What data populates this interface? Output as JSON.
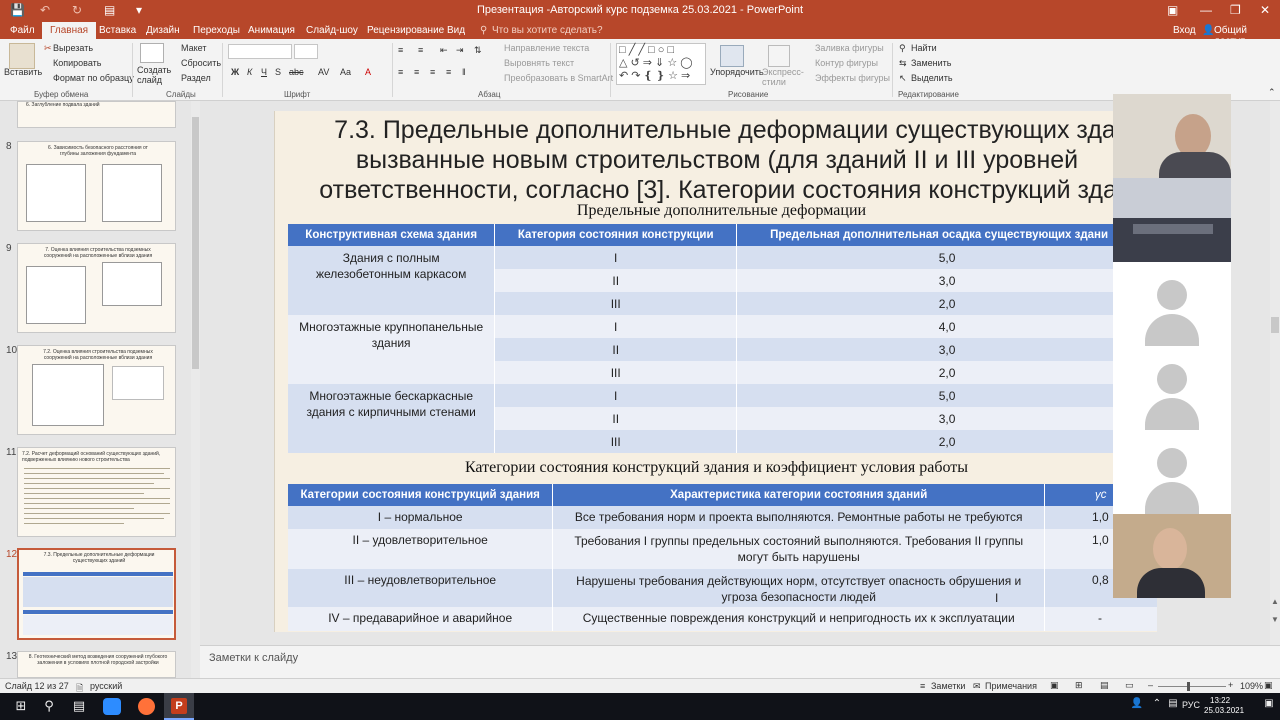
{
  "window": {
    "title": "Презентация -Авторский курс подземка 25.03.2021 - PowerPoint",
    "sign_in": "Вход",
    "share": "Общий доступ"
  },
  "tabs": [
    "Файл",
    "Главная",
    "Вставка",
    "Дизайн",
    "Переходы",
    "Анимация",
    "Слайд-шоу",
    "Рецензирование",
    "Вид"
  ],
  "tell_me": "Что вы хотите сделать?",
  "ribbon": {
    "paste": "Вставить",
    "cut": "Вырезать",
    "copy": "Копировать",
    "format_painter": "Формат по образцу",
    "clipboard_group": "Буфер обмена",
    "new_slide": "Создать слайд",
    "layout": "Макет",
    "reset": "Сбросить",
    "section": "Раздел",
    "slides_group": "Слайды",
    "font_group": "Шрифт",
    "text_direction": "Направление текста",
    "align_text": "Выровнять текст",
    "smartart": "Преобразовать в SmartArt",
    "paragraph_group": "Абзац",
    "arrange": "Упорядочить",
    "quick_styles": "Экспресс-стили",
    "shape_fill": "Заливка фигуры",
    "shape_outline": "Контур фигуры",
    "shape_effects": "Эффекты фигуры",
    "drawing_group": "Рисование",
    "find": "Найти",
    "replace": "Заменить",
    "select": "Выделить",
    "editing_group": "Редактирование"
  },
  "thumbnails": [
    {
      "num": "8",
      "title": "6. Зависимость безопасного расстояния от глубины заложения фундамента"
    },
    {
      "num": "9",
      "title": "7. Оценка влияния строительства подземных сооружений на расположенные вблизи здания"
    },
    {
      "num": "10",
      "title": "7.2. Оценка влияния строительства подземных сооружений на расположенные вблизи здания"
    },
    {
      "num": "11",
      "title": "7.2. Расчет деформаций оснований существующих зданий, подверженных влиянию нового строительства"
    },
    {
      "num": "12",
      "title": "7.3. Предельные дополнительные деформации существующих зданий"
    },
    {
      "num": "13",
      "title": "8. Геотехнический метод возведения сооружений глубокого заложения в условиях плотной городской застройки"
    }
  ],
  "thumb_top_caption": "6. Заглубление подвала зданий",
  "slide": {
    "title_lines": [
      "7.3. Предельные дополнительные деформации существующих зда",
      "вызванные новым строительством (для зданий II и III уровней",
      "ответственности, согласно [3]. Категории состояния конструкций здан"
    ],
    "table1_caption": "Предельные дополнительные деформации",
    "table1_headers": [
      "Конструктивная схема здания",
      "Категория состояния конструкции",
      "Предельная дополнительная осадка существующих здани"
    ],
    "table1_groups": [
      {
        "scheme": "Здания с полным железобетонным каркасом",
        "rows": [
          [
            "I",
            "5,0"
          ],
          [
            "II",
            "3,0"
          ],
          [
            "III",
            "2,0"
          ]
        ]
      },
      {
        "scheme": "Многоэтажные крупнопанельные здания",
        "rows": [
          [
            "I",
            "4,0"
          ],
          [
            "II",
            "3,0"
          ],
          [
            "III",
            "2,0"
          ]
        ]
      },
      {
        "scheme": "Многоэтажные бескаркасные здания с кирпичными стенами",
        "rows": [
          [
            "I",
            "5,0"
          ],
          [
            "II",
            "3,0"
          ],
          [
            "III",
            "2,0"
          ]
        ]
      }
    ],
    "table2_caption": "Категории состояния конструкций здания и коэффициент условия работы",
    "table2_headers": [
      "Категории состояния конструкций здания",
      "Характеристика категории состояния зданий",
      "γc"
    ],
    "table2_rows": [
      [
        "I – нормальное",
        "Все требования норм и проекта выполняются. Ремонтные работы не требуются",
        "1,0"
      ],
      [
        "II – удовлетворительное",
        "Требования I группы предельных состояний выполняются. Требования II группы могут быть нарушены",
        "1,0"
      ],
      [
        "III – неудовлетворительное",
        "Нарушены требования действующих норм, отсутствует опасность обрушения и угроза безопасности людей",
        "0,8"
      ],
      [
        "IV – предаварийное и аварийное",
        "Существенные повреждения конструкций и непригодность их к эксплуатации",
        "-"
      ]
    ]
  },
  "notes_placeholder": "Заметки к слайду",
  "status": {
    "slide_counter": "Слайд 12 из 27",
    "language": "русский",
    "notes": "Заметки",
    "comments": "Примечания",
    "zoom": "109%"
  },
  "taskbar": {
    "lang": "РУС",
    "time": "13:22",
    "date": "25.03.2021"
  },
  "colors": {
    "accent": "#b7472a",
    "table_header": "#4472c4"
  }
}
